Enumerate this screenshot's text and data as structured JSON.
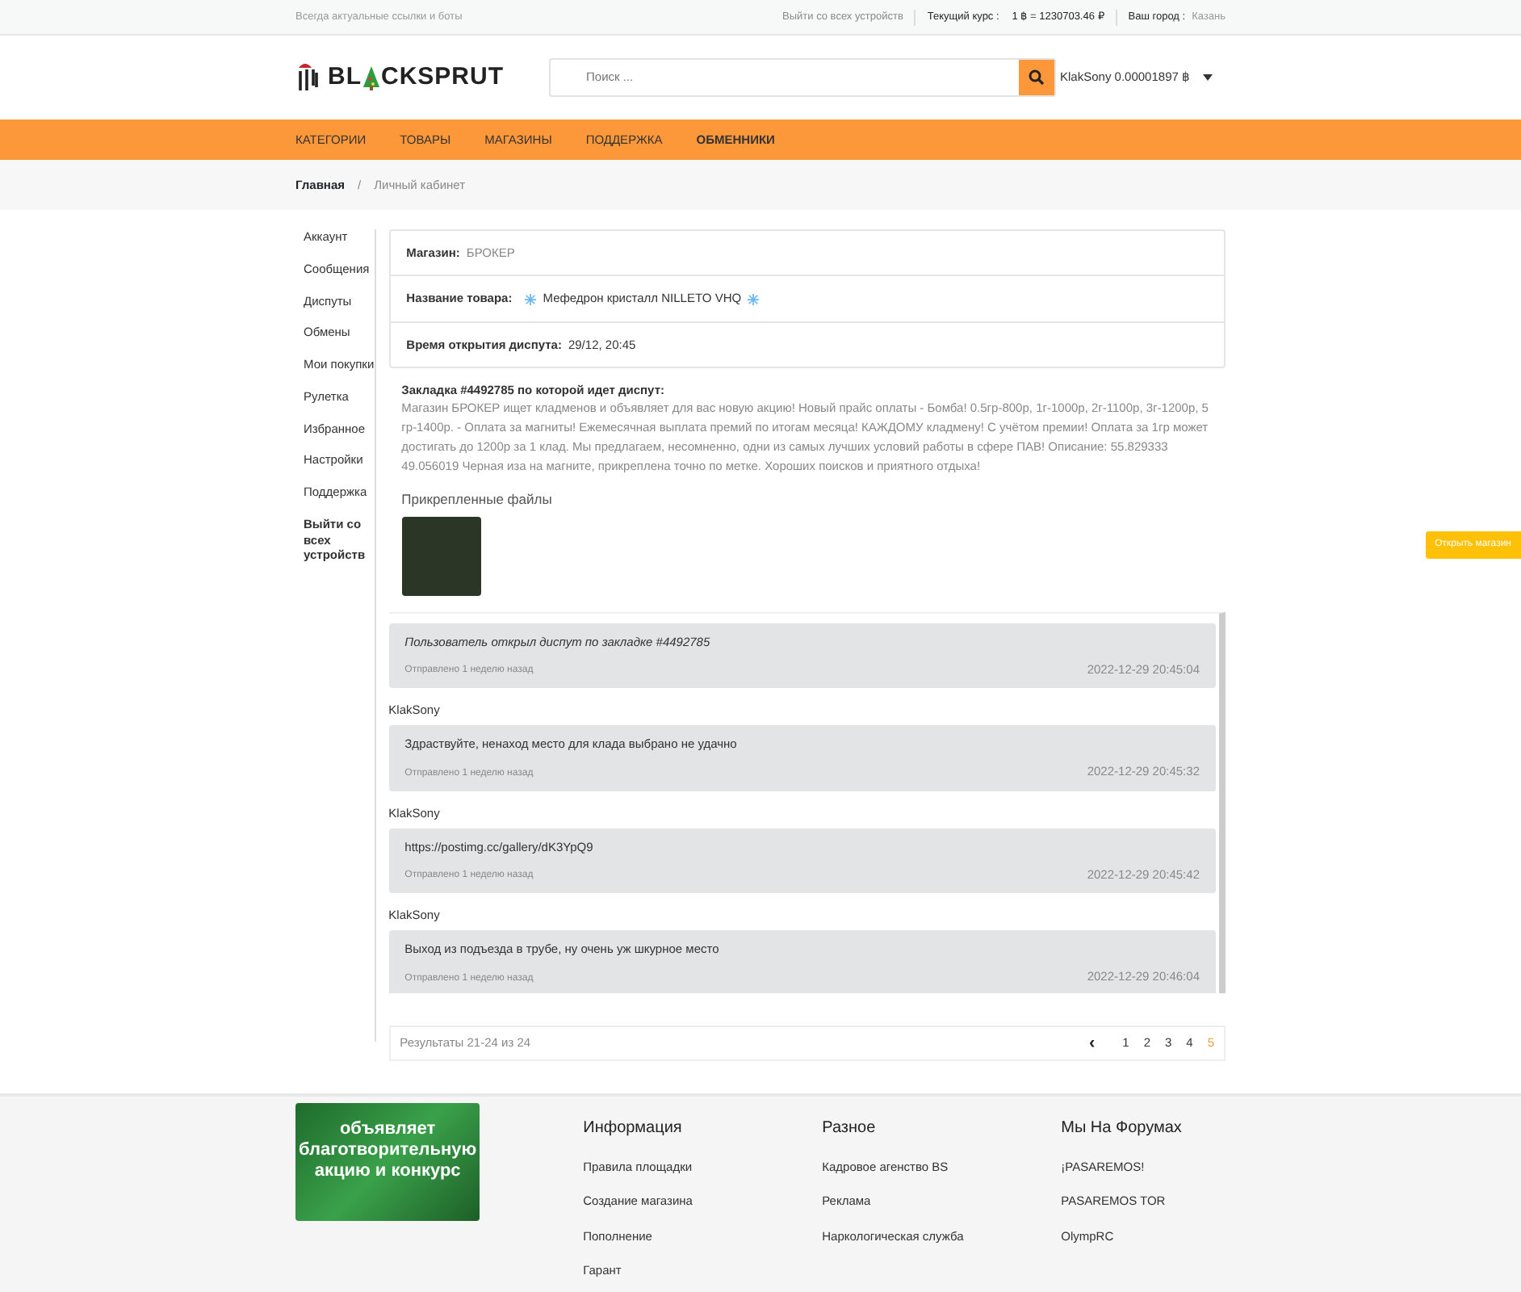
{
  "topbar": {
    "tagline": "Всегда актуальные ссылки и боты",
    "logout_link": "Выйти со всех устройств",
    "rate_label": "Текущий курс :",
    "rate_value": "1 ฿ = 1230703.46 ₽",
    "city_label": "Ваш город :",
    "city_value": "Казань"
  },
  "header": {
    "logo_before": "BL",
    "logo_after": "CKSPRUT",
    "search": {
      "placeholder": "Поиск ..."
    },
    "user": "KlakSony 0.00001897 ฿"
  },
  "nav": [
    {
      "label": "КАТЕГОРИИ",
      "bold": false
    },
    {
      "label": "ТОВАРЫ",
      "bold": false
    },
    {
      "label": "МАГАЗИНЫ",
      "bold": false
    },
    {
      "label": "ПОДДЕРЖКА",
      "bold": false
    },
    {
      "label": "ОБМЕННИКИ",
      "bold": true
    }
  ],
  "breadcrumb": [
    {
      "label": "Главная",
      "current": false
    },
    {
      "label": "Личный кабинет",
      "current": true
    }
  ],
  "breadcrumb_separator": "/",
  "sidebar": [
    {
      "label": "Аккаунт",
      "bold": false
    },
    {
      "label": "Сообщения",
      "bold": false
    },
    {
      "label": "Диспуты",
      "bold": false
    },
    {
      "label": "Обмены",
      "bold": false
    },
    {
      "label": "Мои покупки",
      "bold": false
    },
    {
      "label": "Рулетка",
      "bold": false
    },
    {
      "label": "Избранное",
      "bold": false
    },
    {
      "label": "Настройки",
      "bold": false
    },
    {
      "label": "Поддержка",
      "bold": false
    },
    {
      "label": "Выйти со всех устройств",
      "bold": true
    }
  ],
  "details": [
    {
      "label": "Магазин:",
      "value": "БРОКЕР",
      "kind": "muted"
    },
    {
      "label": "Название товара:",
      "value": "Мефедрон кристалл NILLETO VHQ",
      "kind": "snow"
    },
    {
      "label": "Время открытия диспута:",
      "value": "29/12, 20:45",
      "kind": "plain"
    }
  ],
  "drop": {
    "title": "Закладка #4492785 по которой идет диспут:",
    "description": "Магазин БРОКЕР ищет кладменов и объявляет для вас новую акцию! Новый прайс оплаты - Бомба! 0.5гр-800р, 1г-1000р, 2г-1100р, 3г-1200р, 5 гр-1400р. - Оплата за магниты! Ежемесячная выплата премий по итогам месяца! КАЖДОМУ кладмену! С учётом премии! Оплата за 1гр может достигать до 1200р за 1 клад. Мы предлагаем, несомненно, одни из самых лучших условий работы в сфере ПАВ! Описание: 55.829333 49.056019 Черная иза на магните, прикреплена точно по метке. Хороших поисков и приятного отдыха!",
    "files_title": "Прикрепленные файлы"
  },
  "messages": [
    {
      "kind": "system",
      "text": "Пользователь открыл диспут по закладке #4492785",
      "sent": "Отправлено 1 неделю назад",
      "time": "2022-12-29 20:45:04"
    },
    {
      "kind": "user",
      "sender": "KlakSony",
      "text": "Здраствуйте, ненаход место для клада выбрано не удачно",
      "sent": "Отправлено 1 неделю назад",
      "time": "2022-12-29 20:45:32"
    },
    {
      "kind": "user",
      "sender": "KlakSony",
      "text": "https://postimg.cc/gallery/dK3YpQ9",
      "sent": "Отправлено 1 неделю назад",
      "time": "2022-12-29 20:45:42"
    },
    {
      "kind": "user",
      "sender": "KlakSony",
      "text": "Выход из подъезда в трубе, ну очень уж шкурное место",
      "sent": "Отправлено 1 неделю назад",
      "time": "2022-12-29 20:46:04"
    }
  ],
  "pagination": {
    "results": "Результаты 21-24 из 24",
    "prev": "‹",
    "pages": [
      {
        "label": "1",
        "selected": false
      },
      {
        "label": "2",
        "selected": false
      },
      {
        "label": "3",
        "selected": false
      },
      {
        "label": "4",
        "selected": false
      },
      {
        "label": "5",
        "selected": true
      }
    ]
  },
  "open_shop_button": "Открыть магазин",
  "footer": {
    "banner_text": "объявляет благотворительную акцию и конкурс",
    "columns": [
      {
        "title": "Информация",
        "links": [
          "Правила площадки",
          "Создание магазина",
          "Пополнение",
          "Гарант"
        ]
      },
      {
        "title": "Разное",
        "links": [
          "Кадровое агенство BS",
          "Реклама",
          "Наркологическая служба"
        ]
      },
      {
        "title": "Мы На Форумах",
        "links": [
          "¡PASAREMOS!",
          "PASAREMOS TOR",
          "OlympRC"
        ]
      }
    ]
  }
}
